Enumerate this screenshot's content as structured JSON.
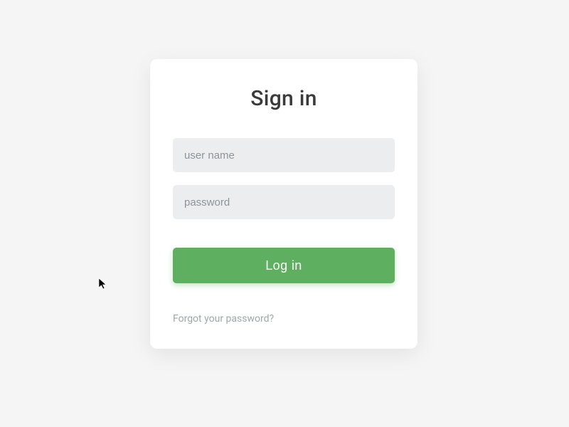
{
  "login": {
    "title": "Sign in",
    "username_placeholder": "user name",
    "username_value": "",
    "password_placeholder": "password",
    "password_value": "",
    "submit_label": "Log in",
    "forgot_label": "Forgot your password?"
  },
  "colors": {
    "card_bg": "#ffffff",
    "page_bg": "#f5f5f5",
    "field_bg": "#ebedef",
    "button_bg": "#5eb060",
    "muted_text": "#a0a5aa"
  }
}
